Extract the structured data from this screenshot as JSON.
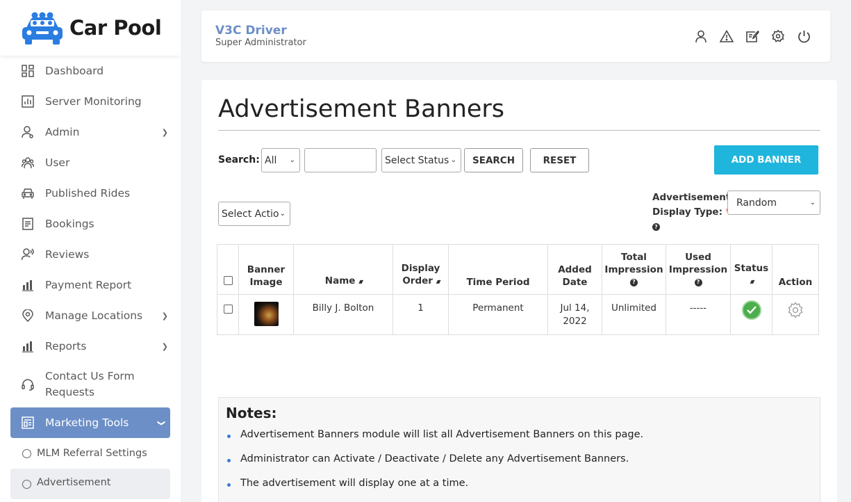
{
  "app": {
    "name": "Car Pool"
  },
  "sidebar": {
    "items": [
      {
        "label": "Dashboard",
        "icon": "dashboard-icon"
      },
      {
        "label": "Server Monitoring",
        "icon": "monitor-chart-icon"
      },
      {
        "label": "Admin",
        "icon": "admin-user-icon",
        "has_children": true
      },
      {
        "label": "User",
        "icon": "users-icon"
      },
      {
        "label": "Published Rides",
        "icon": "car-icon"
      },
      {
        "label": "Bookings",
        "icon": "bookings-icon"
      },
      {
        "label": "Reviews",
        "icon": "reviews-icon"
      },
      {
        "label": "Payment Report",
        "icon": "bar-chart-icon"
      },
      {
        "label": "Manage Locations",
        "icon": "location-pin-icon",
        "has_children": true
      },
      {
        "label": "Reports",
        "icon": "bar-chart-icon",
        "has_children": true
      },
      {
        "label": "Contact Us Form Requests",
        "icon": "headset-icon"
      },
      {
        "label": "Marketing Tools",
        "icon": "marketing-icon",
        "active": true,
        "expanded": true
      }
    ],
    "subitems": [
      {
        "label": "MLM Referral Settings"
      },
      {
        "label": "Advertisement",
        "current": true
      }
    ]
  },
  "header": {
    "title": "V3C Driver",
    "subtitle": "Super Administrator",
    "icons": [
      "profile-icon",
      "alert-icon",
      "edit-icon",
      "settings-icon",
      "power-icon"
    ]
  },
  "main": {
    "title": "Advertisement Banners",
    "search_label": "Search:",
    "filter_select": "All",
    "search_value": "",
    "status_select": "Select Status",
    "search_button": "SEARCH",
    "reset_button": "RESET",
    "add_button": "ADD BANNER",
    "action_select": "Select Actio",
    "display_type_label_1": "Advertisement",
    "display_type_label_2": "Display Type:",
    "display_type_required": "*",
    "display_type_value": "Random"
  },
  "table": {
    "headers": {
      "banner_image_1": "Banner",
      "banner_image_2": "Image",
      "name": "Name",
      "display_order_1": "Display",
      "display_order_2": "Order",
      "time_period": "Time Period",
      "added_date_1": "Added",
      "added_date_2": "Date",
      "total_impression_1": "Total",
      "total_impression_2": "Impression",
      "used_impression_1": "Used",
      "used_impression_2": "Impression",
      "status": "Status",
      "action": "Action"
    },
    "rows": [
      {
        "name": "Billy J. Bolton",
        "display_order": "1",
        "time_period": "Permanent",
        "added_date_1": "Jul 14,",
        "added_date_2": "2022",
        "total_impression": "Unlimited",
        "used_impression": "-----",
        "status": "active"
      }
    ]
  },
  "notes": {
    "title": "Notes:",
    "items": [
      "Advertisement Banners module will list all Advertisement Banners on this page.",
      "Administrator can Activate / Deactivate / Delete any Advertisement Banners.",
      "The advertisement will display one at a time."
    ]
  },
  "colors": {
    "accent": "#6c8fc7",
    "add_button": "#1fb5dc",
    "status_active": "#4cae4c"
  }
}
